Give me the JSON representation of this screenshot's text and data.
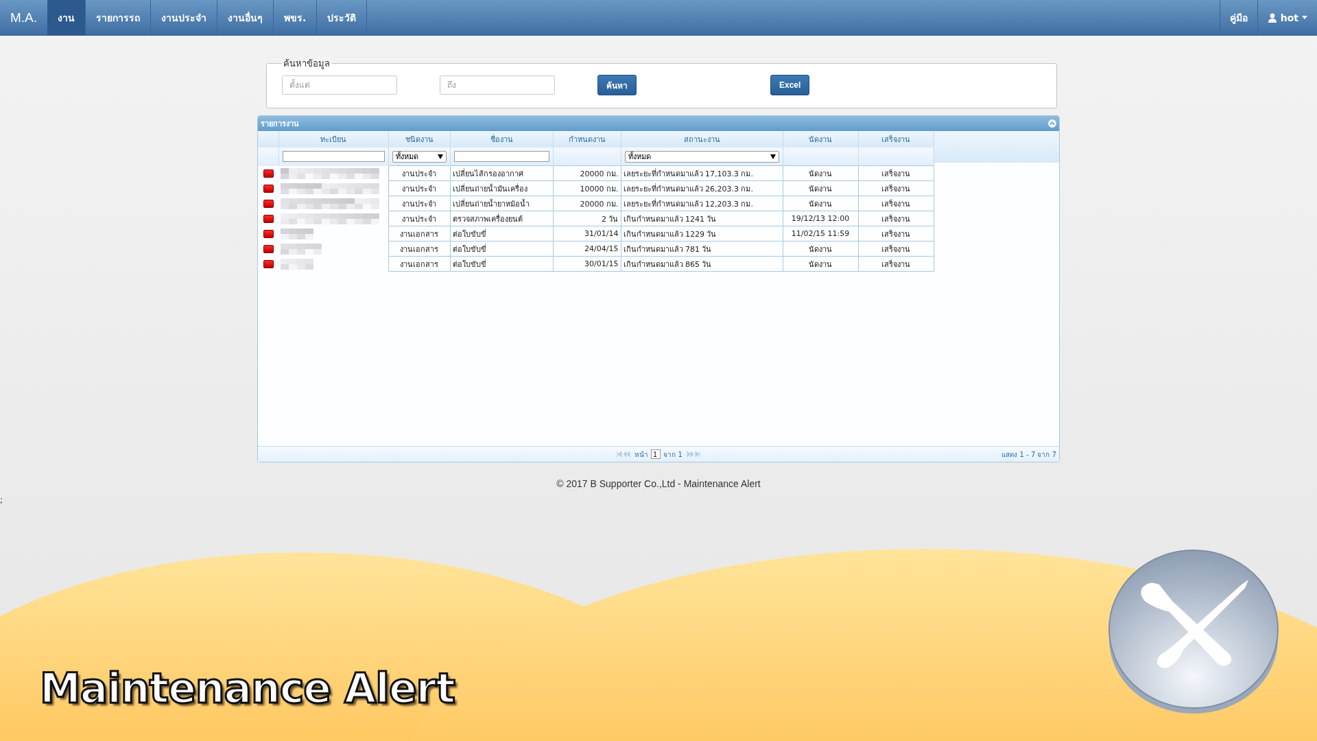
{
  "navbar": {
    "brand": "M.A.",
    "tabs": [
      {
        "label": "งาน",
        "selected": true
      },
      {
        "label": "รายการรถ",
        "selected": false
      },
      {
        "label": "งานประจำ",
        "selected": false
      },
      {
        "label": "งานอื่นๆ",
        "selected": false
      },
      {
        "label": "พขร.",
        "selected": false
      },
      {
        "label": "ประวัติ",
        "selected": false
      }
    ],
    "right": [
      {
        "label": "คู่มือ",
        "kind": "link"
      },
      {
        "label": "hot",
        "kind": "user"
      }
    ]
  },
  "search": {
    "legend": "ค้นหาข้อมูล",
    "from": {
      "placeholder": "ตั้งแต่"
    },
    "to": {
      "placeholder": "ถึง"
    },
    "buttons": [
      "ค้นหา",
      "Excel"
    ]
  },
  "grid": {
    "title": "รายการงาน",
    "columns": [
      "ทะเบียน",
      "ชนิดงาน",
      "ชื่องาน",
      "กำหนดงาน",
      "สถานะงาน",
      "นัดงาน",
      "เสร็จงาน"
    ],
    "filters": [
      {
        "kind": "text"
      },
      {
        "kind": "select",
        "value": "ทั้งหมด"
      },
      {
        "kind": "text"
      },
      {
        "kind": "none"
      },
      {
        "kind": "select",
        "value": "ทั้งหมด"
      },
      {
        "kind": "none"
      },
      {
        "kind": "none"
      }
    ],
    "rows": [
      {
        "type": "งานประจำ",
        "name": "เปลี่ยนไส้กรองอากาศ",
        "due": "20000 กม.",
        "status": "เลยระยะที่กำหนดมาแล้ว 17,103.3 กม.",
        "appointment": "นัดงาน",
        "done": "เสร็จงาน"
      },
      {
        "type": "งานประจำ",
        "name": "เปลี่ยนถ่ายน้ำมันเครื่อง",
        "due": "10000 กม.",
        "status": "เลยระยะที่กำหนดมาแล้ว 26,203.3 กม.",
        "appointment": "นัดงาน",
        "done": "เสร็จงาน"
      },
      {
        "type": "งานประจำ",
        "name": "เปลี่ยนถ่ายน้ำยาหม้อน้ำ",
        "due": "20000 กม.",
        "status": "เลยระยะที่กำหนดมาแล้ว 12,203.3 กม.",
        "appointment": "นัดงาน",
        "done": "เสร็จงาน"
      },
      {
        "type": "งานประจำ",
        "name": "ตรวจสภาพเครื่องยนต์",
        "due": "2 วัน",
        "status": "เกินกำหนดมาแล้ว 1241 วัน",
        "appointment": "19/12/13 12:00",
        "done": "เสร็จงาน"
      },
      {
        "type": "งานเอกสาร",
        "name": "ต่อใบขับขี่",
        "due": "31/01/14",
        "status": "เกินกำหนดมาแล้ว 1229 วัน",
        "appointment": "11/02/15 11:59",
        "done": "เสร็จงาน"
      },
      {
        "type": "งานเอกสาร",
        "name": "ต่อใบขับขี่",
        "due": "24/04/15",
        "status": "เกินกำหนดมาแล้ว 781 วัน",
        "appointment": "นัดงาน",
        "done": "เสร็จงาน"
      },
      {
        "type": "งานเอกสาร",
        "name": "ต่อใบขับขี่",
        "due": "30/01/15",
        "status": "เกินกำหนดมาแล้ว 865 วัน",
        "appointment": "นัดงาน",
        "done": "เสร็จงาน"
      }
    ],
    "pager": {
      "page_label": "หน้า",
      "page": "1",
      "of": "จาก 1",
      "summary": "แสดง 1 - 7 จาก 7"
    }
  },
  "footer": "© 2017 B Supporter Co.,Ltd - Maintenance Alert",
  "stray_mark": ";",
  "banner": {
    "title": "Maintenance Alert"
  }
}
